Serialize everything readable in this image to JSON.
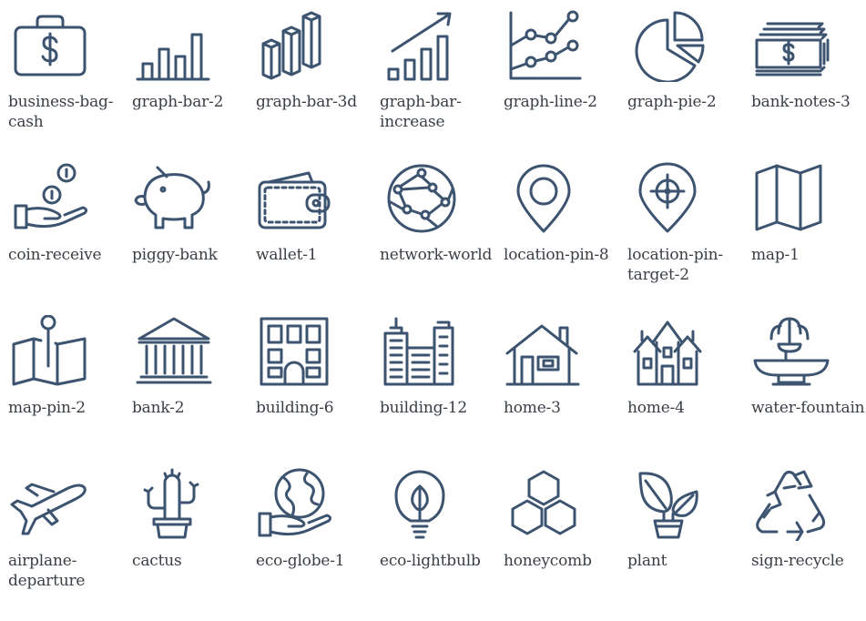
{
  "colors": {
    "icon_stroke": "#3d5470",
    "label_text": "#3a3f46",
    "background": "#ffffff"
  },
  "icons": [
    {
      "name": "business-bag-cash-icon",
      "label": "business-bag-cash"
    },
    {
      "name": "graph-bar-2-icon",
      "label": "graph-bar-2"
    },
    {
      "name": "graph-bar-3d-icon",
      "label": "graph-bar-3d"
    },
    {
      "name": "graph-bar-increase-icon",
      "label": "graph-bar-increase"
    },
    {
      "name": "graph-line-2-icon",
      "label": "graph-line-2"
    },
    {
      "name": "graph-pie-2-icon",
      "label": "graph-pie-2"
    },
    {
      "name": "bank-notes-3-icon",
      "label": "bank-notes-3"
    },
    {
      "name": "coin-receive-icon",
      "label": "coin-receive"
    },
    {
      "name": "piggy-bank-icon",
      "label": "piggy-bank"
    },
    {
      "name": "wallet-1-icon",
      "label": "wallet-1"
    },
    {
      "name": "network-world-icon",
      "label": "network-world"
    },
    {
      "name": "location-pin-8-icon",
      "label": "location-pin-8"
    },
    {
      "name": "location-pin-target-2-icon",
      "label": "location-pin-target-2"
    },
    {
      "name": "map-1-icon",
      "label": "map-1"
    },
    {
      "name": "map-pin-2-icon",
      "label": "map-pin-2"
    },
    {
      "name": "bank-2-icon",
      "label": "bank-2"
    },
    {
      "name": "building-6-icon",
      "label": "building-6"
    },
    {
      "name": "building-12-icon",
      "label": "building-12"
    },
    {
      "name": "home-3-icon",
      "label": "home-3"
    },
    {
      "name": "home-4-icon",
      "label": "home-4"
    },
    {
      "name": "water-fountain-icon",
      "label": "water-fountain"
    },
    {
      "name": "airplane-departure-icon",
      "label": "airplane-departure"
    },
    {
      "name": "cactus-icon",
      "label": "cactus"
    },
    {
      "name": "eco-globe-1-icon",
      "label": "eco-globe-1"
    },
    {
      "name": "eco-lightbulb-icon",
      "label": "eco-lightbulb"
    },
    {
      "name": "honeycomb-icon",
      "label": "honeycomb"
    },
    {
      "name": "plant-icon",
      "label": "plant"
    },
    {
      "name": "sign-recycle-icon",
      "label": "sign-recycle"
    }
  ]
}
